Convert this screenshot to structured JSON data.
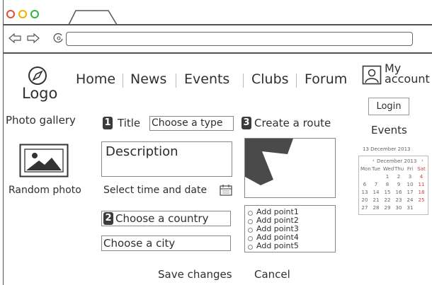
{
  "browser": {
    "traffic_colors": [
      "#e24a3b",
      "#f0b000",
      "#2db24a"
    ]
  },
  "header": {
    "logo_label": "Logo",
    "nav": [
      "Home",
      "News",
      "Events",
      "Clubs",
      "Forum"
    ],
    "account_label_line1": "My",
    "account_label_line2": "account"
  },
  "left": {
    "photo_gallery": "Photo gallery",
    "random_photo": "Random photo"
  },
  "form": {
    "step1_num": "1",
    "title_label": "Title",
    "type_select": "Choose a type",
    "description": "Description",
    "select_time_label": "Select time and date",
    "step2_num": "2",
    "country_select": "Choose a country",
    "city_select": "Choose a city",
    "save": "Save changes",
    "cancel": "Cancel"
  },
  "route": {
    "step3_num": "3",
    "label": "Create a route",
    "points": [
      "Add point1",
      "Add point2",
      "Add point3",
      "Add point4",
      "Add point5"
    ]
  },
  "right": {
    "login": "Login",
    "events": "Events",
    "date_line": "13 December 2013",
    "cal_title": "December 2013",
    "weekdays": [
      "Mon",
      "Tue",
      "Wed",
      "Thu",
      "Fri",
      "Sat"
    ],
    "rows": [
      [
        "",
        "",
        "1",
        "2",
        "3",
        "4"
      ],
      [
        "6",
        "7",
        "8",
        "9",
        "10",
        "11"
      ],
      [
        "13",
        "14",
        "15",
        "16",
        "17",
        "18"
      ],
      [
        "20",
        "21",
        "22",
        "23",
        "24",
        "25"
      ],
      [
        "27",
        "28",
        "29",
        "30",
        "31",
        ""
      ]
    ]
  }
}
